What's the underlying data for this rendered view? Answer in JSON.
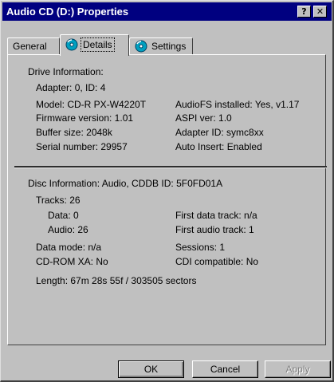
{
  "window": {
    "title": "Audio CD (D:) Properties",
    "help_glyph": "?",
    "close_glyph": "✕"
  },
  "tabs": [
    {
      "label": "General",
      "icon": null,
      "active": false
    },
    {
      "label": "Details",
      "icon": "cd-audio-icon",
      "active": true
    },
    {
      "label": "Settings",
      "icon": "cd-audio-icon",
      "active": false
    }
  ],
  "drive": {
    "heading": "Drive Information:",
    "adapter": "Adapter: 0, ID: 4",
    "model": "Model: CD-R   PX-W4220T",
    "firmware": "Firmware version: 1.01",
    "buffer": "Buffer size: 2048k",
    "serial": "Serial number: 29957",
    "audiofs": "AudioFS installed: Yes, v1.17",
    "aspi": "ASPI ver: 1.0",
    "adapter_id": "Adapter ID: symc8xx",
    "auto_insert": "Auto Insert: Enabled"
  },
  "disc": {
    "heading": "Disc Information: Audio, CDDB ID: 5F0FD01A",
    "tracks": "Tracks: 26",
    "data": "Data: 0",
    "audio": "Audio: 26",
    "first_data": "First data track: n/a",
    "first_audio": "First audio track: 1",
    "data_mode": "Data mode: n/a",
    "cdrom_xa": "CD-ROM XA: No",
    "sessions": "Sessions: 1",
    "cdi": "CDI compatible: No",
    "length": "Length: 67m 28s 55f / 303505 sectors"
  },
  "buttons": {
    "ok": "OK",
    "cancel": "Cancel",
    "apply": "Apply"
  },
  "colors": {
    "titlebar": "#000080",
    "face": "#c0c0c0"
  }
}
